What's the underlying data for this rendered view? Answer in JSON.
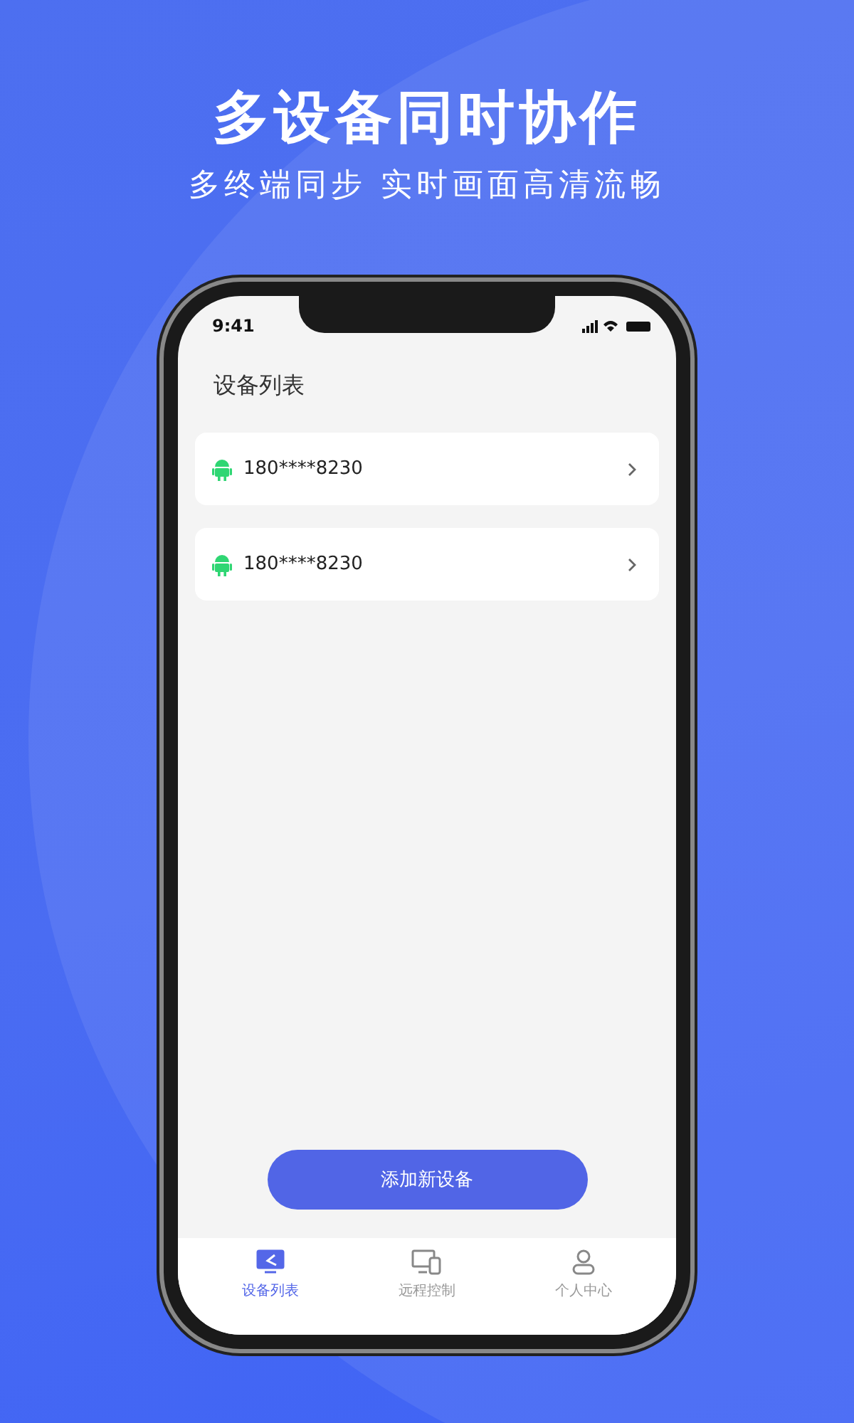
{
  "headline": "多设备同时协作",
  "subheadline": "多终端同步 实时画面高清流畅",
  "status_bar": {
    "time": "9:41"
  },
  "page_title": "设备列表",
  "devices": [
    {
      "label": "180****8230",
      "kind": "android"
    },
    {
      "label": "180****8230",
      "kind": "android"
    }
  ],
  "add_button": "添加新设备",
  "tabs": [
    {
      "label": "设备列表",
      "selected": true,
      "kind": "devices"
    },
    {
      "label": "远程控制",
      "selected": false,
      "kind": "remote"
    },
    {
      "label": "个人中心",
      "selected": false,
      "kind": "profile"
    }
  ]
}
